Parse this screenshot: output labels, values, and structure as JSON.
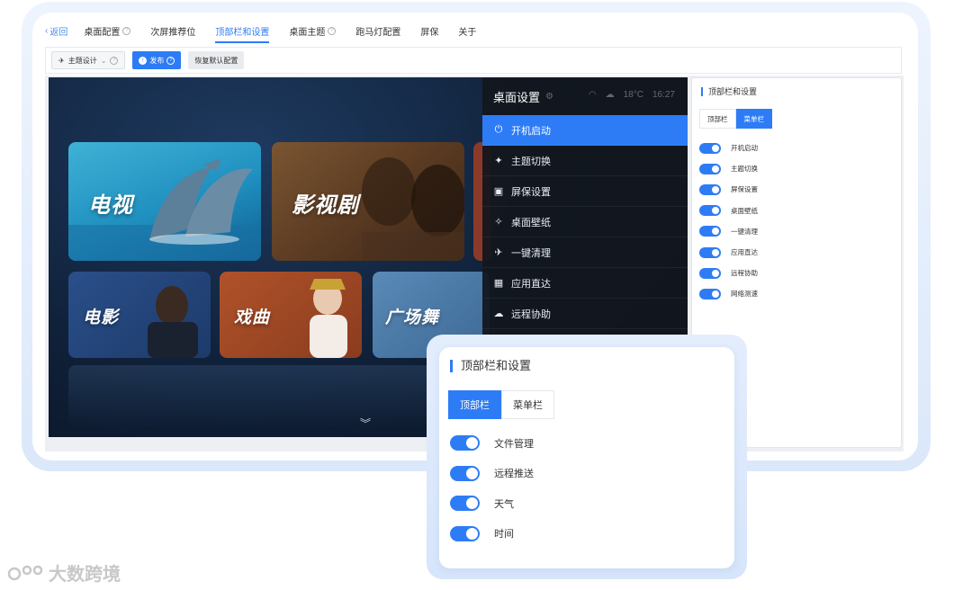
{
  "nav": {
    "back": "返回",
    "items": [
      {
        "label": "桌面配置",
        "help": true,
        "active": false
      },
      {
        "label": "次屏推荐位",
        "help": false,
        "active": false
      },
      {
        "label": "顶部栏和设置",
        "help": false,
        "active": true
      },
      {
        "label": "桌面主题",
        "help": true,
        "active": false
      },
      {
        "label": "跑马灯配置",
        "help": false,
        "active": false
      },
      {
        "label": "屏保",
        "help": false,
        "active": false
      },
      {
        "label": "关于",
        "help": false,
        "active": false
      }
    ]
  },
  "toolbar": {
    "theme_select": "主题设计",
    "publish": "发布",
    "reset": "恢复默认配置"
  },
  "tv": {
    "tiles": [
      "电视",
      "影视剧",
      "电影",
      "戏曲",
      "广场舞"
    ],
    "status_weather": "18°C",
    "status_time": "16:27"
  },
  "menu": {
    "title": "桌面设置",
    "items": [
      {
        "label": "开机启动",
        "icon": "power-icon",
        "glyph": "⏻",
        "active": true
      },
      {
        "label": "主题切换",
        "icon": "pin-icon",
        "glyph": "✦",
        "active": false
      },
      {
        "label": "屏保设置",
        "icon": "screensaver-icon",
        "glyph": "▣",
        "active": false
      },
      {
        "label": "桌面壁纸",
        "icon": "wallpaper-icon",
        "glyph": "✧",
        "active": false
      },
      {
        "label": "一键清理",
        "icon": "broom-icon",
        "glyph": "✈",
        "active": false
      },
      {
        "label": "应用直达",
        "icon": "apps-icon",
        "glyph": "▦",
        "active": false
      },
      {
        "label": "远程协助",
        "icon": "remote-icon",
        "glyph": "☁",
        "active": false
      }
    ]
  },
  "panel": {
    "title": "顶部栏和设置",
    "tabs": [
      {
        "label": "顶部栏",
        "on": false
      },
      {
        "label": "菜单栏",
        "on": true
      }
    ],
    "items": [
      {
        "label": "开机启动",
        "enabled": true
      },
      {
        "label": "主题切换",
        "enabled": true
      },
      {
        "label": "屏保设置",
        "enabled": true
      },
      {
        "label": "桌面壁纸",
        "enabled": true
      },
      {
        "label": "一键清理",
        "enabled": true
      },
      {
        "label": "应用直达",
        "enabled": true
      },
      {
        "label": "远程协助",
        "enabled": true
      },
      {
        "label": "网络测速",
        "enabled": true
      }
    ]
  },
  "zoom": {
    "title": "顶部栏和设置",
    "tabs": [
      {
        "label": "顶部栏",
        "on": true
      },
      {
        "label": "菜单栏",
        "on": false
      }
    ],
    "items": [
      {
        "label": "文件管理",
        "enabled": true
      },
      {
        "label": "远程推送",
        "enabled": true
      },
      {
        "label": "天气",
        "enabled": true
      },
      {
        "label": "时间",
        "enabled": true
      }
    ]
  },
  "watermark": "大数跨境",
  "colors": {
    "accent": "#2d7cf6",
    "menu_bg": "#12161e",
    "tv_bg": "#0f2038"
  }
}
